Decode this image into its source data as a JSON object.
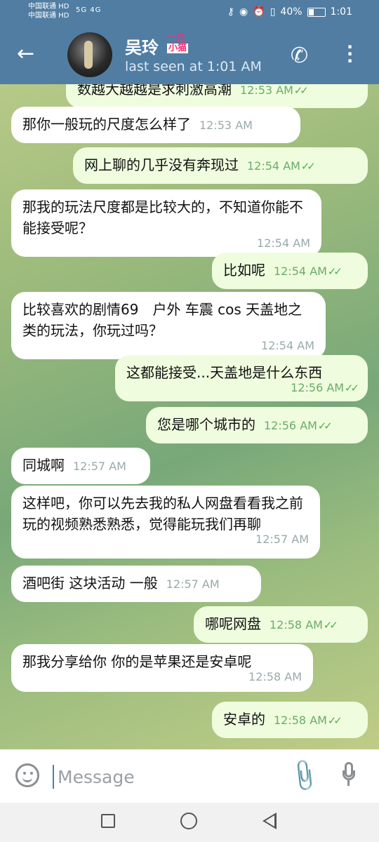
{
  "status_bar": {
    "carrier1": "中国联通 HD",
    "carrier2": "中国联通 HD",
    "signal": "5G 4G",
    "battery": "40%",
    "battery_level": 0.4,
    "time": "1:01"
  },
  "header": {
    "name": "吴玲",
    "sticker_line1": "一只",
    "sticker_line2": "小猫",
    "last_seen": "last seen at 1:01 AM"
  },
  "messages": [
    {
      "side": "out",
      "text": "数越大越越是求刺激高潮",
      "time": "12:53 AM",
      "read": true
    },
    {
      "side": "in",
      "text": "那你一般玩的尺度怎么样了",
      "time": "12:53 AM"
    },
    {
      "side": "out",
      "text": "网上聊的几乎没有奔现过",
      "time": "12:54 AM",
      "read": true
    },
    {
      "side": "in",
      "text": "那我的玩法尺度都是比较大的，不知道你能不能接受呢？",
      "time": "12:54 AM"
    },
    {
      "side": "out",
      "text": "比如呢",
      "time": "12:54 AM",
      "read": true
    },
    {
      "side": "in",
      "text": "比较喜欢的剧情69　户外 车震 cos 天盖地之类的玩法，你玩过吗？",
      "time": "12:54 AM"
    },
    {
      "side": "out",
      "text": "这都能接受...天盖地是什么东西",
      "time": "12:56 AM",
      "read": true
    },
    {
      "side": "out",
      "text": "您是哪个城市的",
      "time": "12:56 AM",
      "read": true
    },
    {
      "side": "in",
      "text": "同城啊",
      "time": "12:57 AM"
    },
    {
      "side": "in",
      "text": "这样吧，你可以先去我的私人网盘看看我之前玩的视频熟悉熟悉，觉得能玩我们再聊",
      "time": "12:57 AM"
    },
    {
      "side": "in",
      "text": "酒吧街 这块活动 一般",
      "time": "12:57 AM"
    },
    {
      "side": "out",
      "text": "哪呢网盘",
      "time": "12:58 AM",
      "read": true
    },
    {
      "side": "in",
      "text": "那我分享给你  你的是苹果还是安卓呢",
      "time": "12:58 AM"
    },
    {
      "side": "out",
      "text": "安卓的",
      "time": "12:58 AM",
      "read": true
    }
  ],
  "composer": {
    "placeholder": "Message"
  },
  "icons": {
    "back": "back-arrow-icon",
    "phone": "phone-icon",
    "menu": "more-vertical-icon",
    "emoji": "emoji-icon",
    "attach": "paperclip-icon",
    "mic": "microphone-icon"
  }
}
